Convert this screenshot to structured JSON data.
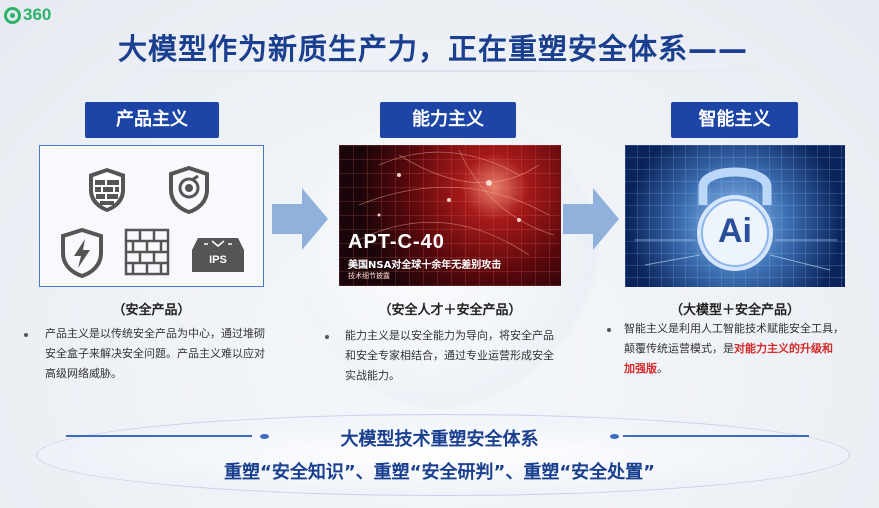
{
  "logo": {
    "text": "360"
  },
  "title": "大模型作为新质生产力，正在重塑安全体系——",
  "columns": [
    {
      "header": "产品主义",
      "caption": "（安全产品）",
      "desc_lines": [
        "产品主义是以传统安全产品为中心，通过堆砌",
        "安全盒子来解决安全问题。产品主义难以应对",
        "高级网络威胁。"
      ],
      "icons": [
        {
          "name": "shield-firewall-icon"
        },
        {
          "name": "shield-target-icon"
        },
        {
          "name": "shield-lightning-icon"
        },
        {
          "name": "firewall-wall-icon"
        },
        {
          "name": "ips-device-icon",
          "label": "IPS"
        }
      ]
    },
    {
      "header": "能力主义",
      "caption": "（安全人才＋安全产品）",
      "desc_lines": [
        "能力主义是以安全能力为导向，将安全产品",
        "和安全专家相结合，通过专业运营形成安全",
        "实战能力。"
      ],
      "image": {
        "title": "APT-C-40",
        "subtitle": "美国NSA对全球十余年无差别攻击",
        "subtitle2": "技术细节披露"
      }
    },
    {
      "header": "智能主义",
      "caption": "（大模型＋安全产品）",
      "desc_lines": [
        "智能主义是利用人工智能技术赋能安全工具，",
        "颠覆传统运营模式，是"
      ],
      "desc_highlight_1": "对能力主义的升级和",
      "desc_highlight_2": "加强版",
      "desc_end": "。",
      "image": {
        "label": "Ai"
      }
    }
  ],
  "bottom": {
    "title": "大模型技术重塑安全体系",
    "subtitle": "重塑“安全知识”、重塑“安全研判”、重塑“安全处置”"
  },
  "colors": {
    "header_bg": "#1d45a6",
    "title": "#1a3f8f",
    "highlight": "#d42b2b",
    "logo": "#2bb36b",
    "arrow": "#8fb1dc"
  }
}
